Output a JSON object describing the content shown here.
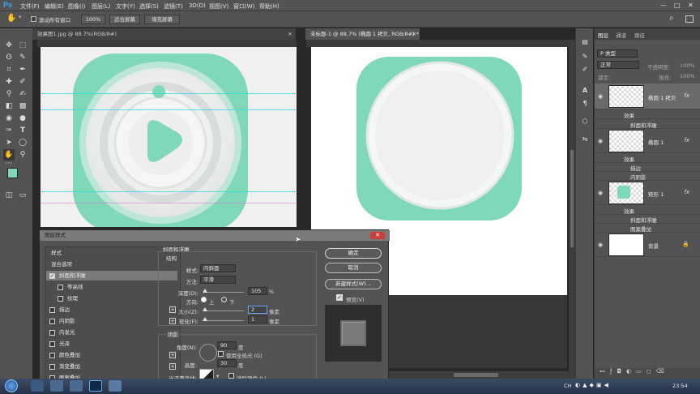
{
  "menubar": {
    "logo": "Ps",
    "items": [
      "文件(F)",
      "编辑(E)",
      "图像(I)",
      "图层(L)",
      "文字(Y)",
      "选择(S)",
      "滤镜(T)",
      "3D(D)",
      "视图(V)",
      "窗口(W)",
      "帮助(H)"
    ],
    "window_controls": [
      "—",
      "□",
      "✕"
    ]
  },
  "options": {
    "scroll_all": "滚动所有窗口",
    "zoom_value": "100%",
    "fit_screen": "适合屏幕",
    "fill_screen": "填充屏幕"
  },
  "documents": [
    {
      "title": "效果图1.jpg @ 88.7%(RGB/8#)",
      "close": "×"
    },
    {
      "title": "未标题-1 @ 88.7% (椭圆 1 拷贝, RGB/8#) *",
      "close": "×"
    }
  ],
  "layers_panel": {
    "tabs": [
      "图层",
      "通道",
      "路径"
    ],
    "filter_placeholder": "P 类型",
    "blend_mode": "正常",
    "opacity_label": "不透明度:",
    "opacity_value": "100%",
    "lock_label": "锁定:",
    "fill_label": "填充:",
    "fill_value": "100%",
    "layers": [
      {
        "name": "椭圆 1 拷贝",
        "fx": "fx",
        "effects_label": "效果",
        "effects": [
          "斜面和浮雕"
        ]
      },
      {
        "name": "椭圆 1",
        "fx": "fx",
        "effects_label": "效果",
        "effects": [
          "描边",
          "内阴影"
        ]
      },
      {
        "name": "矩形 1",
        "fx": "fx",
        "effects_label": "效果",
        "effects": [
          "斜面和浮雕",
          "图案叠加"
        ]
      },
      {
        "name": "背景",
        "lock": "🔒"
      }
    ]
  },
  "dialog": {
    "title": "图层样式",
    "close": "✕",
    "list": [
      {
        "label": "样式",
        "check": false,
        "plus": false,
        "nocheck": true
      },
      {
        "label": "混合选项",
        "check": false,
        "plus": false,
        "nocheck": true
      },
      {
        "label": "斜面和浮雕",
        "check": true,
        "plus": false,
        "selected": true
      },
      {
        "label": "等高线",
        "check": false,
        "plus": false,
        "indent": true
      },
      {
        "label": "纹理",
        "check": false,
        "plus": false,
        "indent": true
      },
      {
        "label": "描边",
        "check": false,
        "plus": true
      },
      {
        "label": "内阴影",
        "check": false,
        "plus": true
      },
      {
        "label": "内发光",
        "check": false,
        "plus": false
      },
      {
        "label": "光泽",
        "check": false,
        "plus": false
      },
      {
        "label": "颜色叠加",
        "check": false,
        "plus": true
      },
      {
        "label": "渐变叠加",
        "check": false,
        "plus": true
      },
      {
        "label": "图案叠加",
        "check": false,
        "plus": false
      }
    ],
    "section_title": "斜面和浮雕",
    "structure_title": "结构",
    "style_label": "样式:",
    "style_value": "内斜面",
    "method_label": "方法:",
    "method_value": "平滑",
    "depth_label": "深度(D):",
    "depth_value": "105",
    "depth_unit": "%",
    "direction_label": "方向:",
    "dir_up": "上",
    "dir_down": "下",
    "size_label": "大小(Z):",
    "size_value": "2",
    "size_unit": "像素",
    "soften_label": "软化(F):",
    "soften_value": "1",
    "soften_unit": "像素",
    "shading_title": "阴影",
    "angle_label": "角度(N):",
    "angle_value": "90",
    "angle_unit": "度",
    "global_light": "使用全局光 (G)",
    "altitude_label": "高度:",
    "altitude_value": "30",
    "altitude_unit": "度",
    "gloss_label": "光泽等高线:",
    "anti_alias": "消除锯齿 (L)",
    "ok": "确定",
    "cancel": "取消",
    "new_style": "新建样式(W)...",
    "preview": "预览(V)"
  },
  "taskbar": {
    "tray": "CH",
    "time": "23:54"
  },
  "colors": {
    "mint": "#7fd8b7",
    "mint_dark": "#64c8a3"
  }
}
